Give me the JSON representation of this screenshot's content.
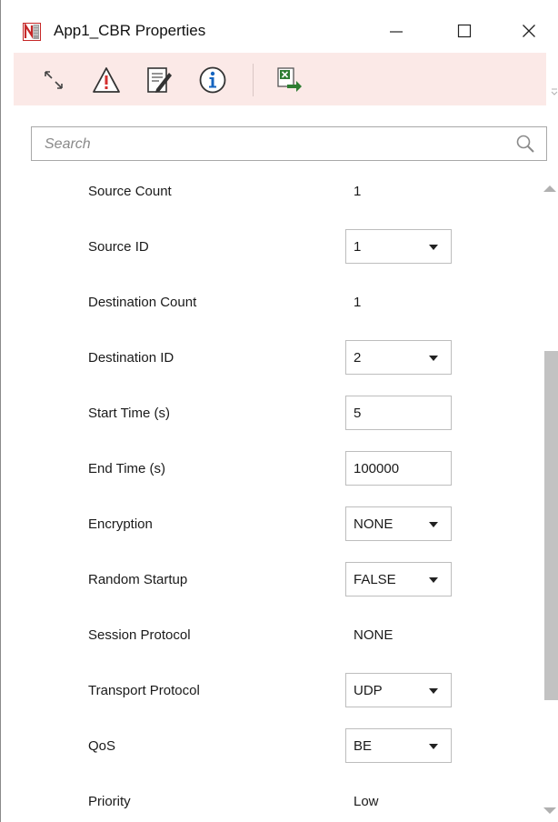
{
  "window": {
    "title": "App1_CBR Properties",
    "min_symbol": "—",
    "max_symbol": "☐",
    "close_symbol": "✕"
  },
  "toolbar": {
    "items": [
      {
        "icon": "expand-icon"
      },
      {
        "icon": "warning-icon"
      },
      {
        "icon": "edit-document-icon"
      },
      {
        "icon": "info-icon"
      },
      {
        "icon": "export-excel-icon"
      }
    ],
    "background": "#fbe9e7"
  },
  "search": {
    "placeholder": "Search",
    "value": ""
  },
  "properties": [
    {
      "label": "Source Count",
      "value": "1",
      "kind": "text"
    },
    {
      "label": "Source ID",
      "value": "1",
      "kind": "dropdown"
    },
    {
      "label": "Destination Count",
      "value": "1",
      "kind": "text"
    },
    {
      "label": "Destination ID",
      "value": "2",
      "kind": "dropdown"
    },
    {
      "label": "Start Time (s)",
      "value": "5",
      "kind": "input"
    },
    {
      "label": "End Time (s)",
      "value": "100000",
      "kind": "input"
    },
    {
      "label": "Encryption",
      "value": "NONE",
      "kind": "dropdown"
    },
    {
      "label": "Random Startup",
      "value": "FALSE",
      "kind": "dropdown"
    },
    {
      "label": "Session Protocol",
      "value": "NONE",
      "kind": "text"
    },
    {
      "label": "Transport Protocol",
      "value": "UDP",
      "kind": "dropdown"
    },
    {
      "label": "QoS",
      "value": "BE",
      "kind": "dropdown"
    },
    {
      "label": "Priority",
      "value": "Low",
      "kind": "text"
    }
  ]
}
